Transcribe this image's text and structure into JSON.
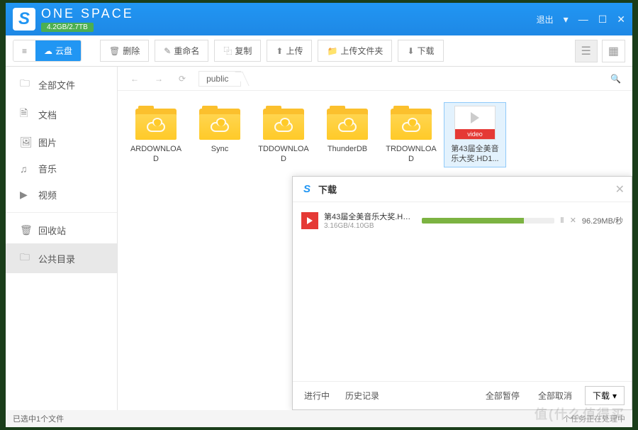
{
  "titlebar": {
    "appName": "ONE SPACE",
    "storage": "4.2GB/2.7TB",
    "exit": "退出"
  },
  "tabs": {
    "local": "|||",
    "cloud": "云盘"
  },
  "toolbar": {
    "delete": "删除",
    "rename": "重命名",
    "copy": "复制",
    "upload": "上传",
    "uploadFolder": "上传文件夹",
    "download": "下载"
  },
  "breadcrumb": {
    "path": "public"
  },
  "sidebar": {
    "items": [
      {
        "icon": "🗀",
        "label": "全部文件"
      },
      {
        "icon": "🗎",
        "label": "文档"
      },
      {
        "icon": "🖼",
        "label": "图片"
      },
      {
        "icon": "♫",
        "label": "音乐"
      },
      {
        "icon": "▶",
        "label": "视频"
      }
    ],
    "trash": {
      "icon": "🗑",
      "label": "回收站"
    },
    "public": {
      "icon": "🗀",
      "label": "公共目录"
    }
  },
  "files": [
    {
      "type": "folder",
      "name": "ARDOWNLOAD"
    },
    {
      "type": "folder",
      "name": "Sync"
    },
    {
      "type": "folder",
      "name": "TDDOWNLOAD"
    },
    {
      "type": "folder",
      "name": "ThunderDB"
    },
    {
      "type": "folder",
      "name": "TRDOWNLOAD"
    },
    {
      "type": "video",
      "name": "第43届全美音乐大奖.HD1...",
      "badge": "video",
      "selected": true
    }
  ],
  "popup": {
    "title": "下载",
    "item": {
      "name": "第43届全美音乐大奖.HD12...",
      "size": "3.16GB/4.10GB",
      "speed": "96.29MB/秒",
      "progress": 77
    },
    "footer": {
      "inProgress": "进行中",
      "history": "历史记录",
      "pauseAll": "全部暂停",
      "cancelAll": "全部取消",
      "download": "下载"
    }
  },
  "status": {
    "left": "已选中1个文件",
    "right": "个任务正在处理中"
  },
  "watermark": "值(什么值得买"
}
